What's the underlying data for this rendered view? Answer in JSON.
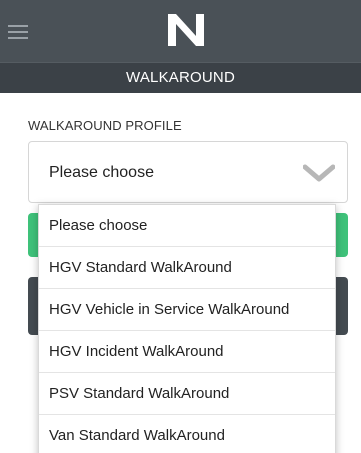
{
  "header": {
    "title": "WALKAROUND",
    "logo_text": "N"
  },
  "form": {
    "section_label": "WALKAROUND PROFILE",
    "select": {
      "selected_value": "Please choose",
      "options": [
        "Please choose",
        "HGV Standard WalkAround",
        "HGV Vehicle in Service WalkAround",
        "HGV Incident WalkAround",
        "PSV Standard WalkAround",
        "Van Standard WalkAround"
      ]
    }
  },
  "colors": {
    "topbar": "#4a5157",
    "subbar": "#3b4147",
    "accent_green": "#3fc27a",
    "dark_button": "#444b51"
  }
}
